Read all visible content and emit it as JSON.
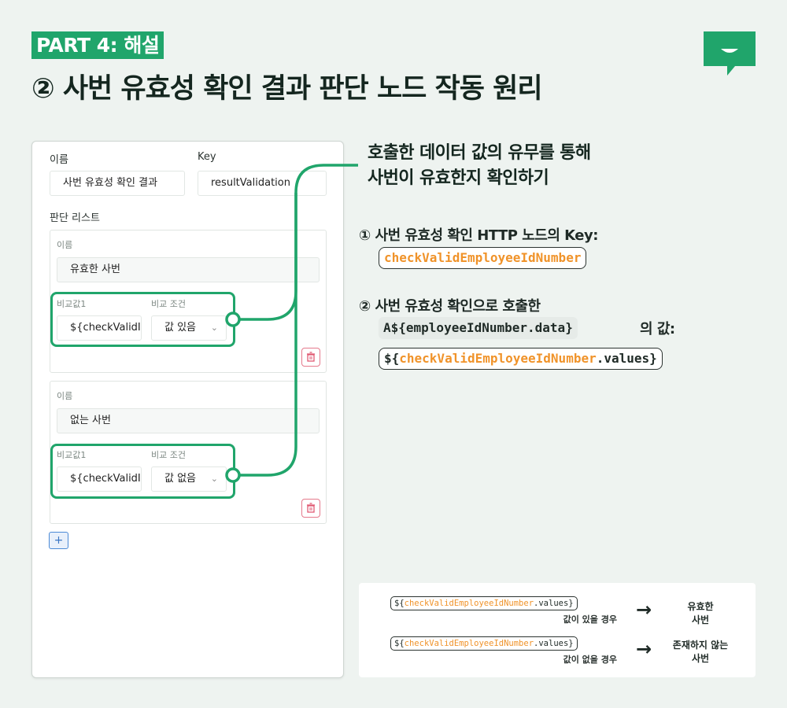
{
  "header": {
    "part_badge": "PART 4: 해설",
    "title": "② 사번 유효성 확인 결과 판단 노드 작동 원리"
  },
  "colors": {
    "accent": "#20a56b",
    "code_highlight": "#f0932a",
    "background": "#eef3f0"
  },
  "form": {
    "name_label": "이름",
    "name_value": "사번 유효성 확인 결과",
    "key_label": "Key",
    "key_value": "resultValidation",
    "list_label": "판단 리스트",
    "items": [
      {
        "name_label": "이름",
        "name_value": "유효한 사번",
        "compare_label": "비교값1",
        "compare_value": "${checkValidI",
        "condition_label": "비교 조건",
        "condition_value": "값 있음"
      },
      {
        "name_label": "이름",
        "name_value": "없는 사번",
        "compare_label": "비교값1",
        "compare_value": "${checkValidI",
        "condition_label": "비교 조건",
        "condition_value": "값 없음"
      }
    ],
    "add_button": "+"
  },
  "callout": {
    "line1": "호출한 데이터 값의 유무를 통해",
    "line2": "사번이 유효한지 확인하기"
  },
  "steps": {
    "step1_text": "① 사번 유효성 확인 HTTP 노드의 Key:",
    "step1_code": "checkValidEmployeeIdNumber",
    "step2_text": "② 사번 유효성 확인으로 호출한",
    "step2_code": "A${employeeIdNumber.data}",
    "step2_suffix": "의 값:",
    "step2_result_prefix": "${",
    "step2_result_key": "checkValidEmployeeIdNumber",
    "step2_result_suffix": ".values}"
  },
  "summary": {
    "rows": [
      {
        "code_prefix": "${",
        "code_key": "checkValidEmployeeIdNumber",
        "code_suffix": ".values}",
        "condition": "값이 있을 경우",
        "arrow": "→",
        "result_line1": "유효한",
        "result_line2": "사번"
      },
      {
        "code_prefix": "${",
        "code_key": "checkValidEmployeeIdNumber",
        "code_suffix": ".values}",
        "condition": "값이 없을 경우",
        "arrow": "→",
        "result_line1": "존재하지 않는",
        "result_line2": "사번"
      }
    ]
  }
}
